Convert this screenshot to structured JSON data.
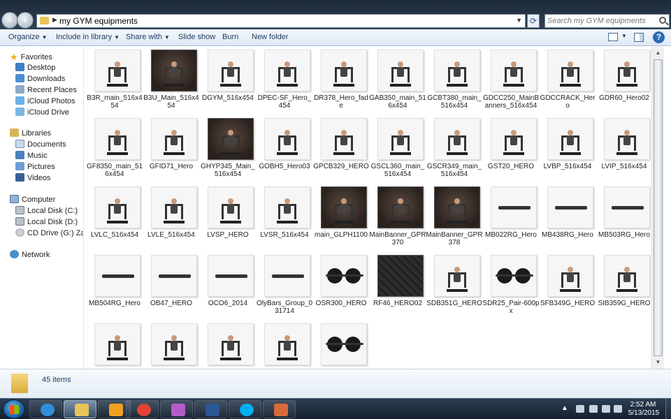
{
  "window": {
    "path": "my GYM equipments",
    "search_placeholder": "Search my GYM equipments"
  },
  "toolbar": {
    "organize": "Organize",
    "include": "Include in library",
    "share": "Share with",
    "slideshow": "Slide show",
    "burn": "Burn",
    "new_folder": "New folder"
  },
  "nav": {
    "favorites": "Favorites",
    "desktop": "Desktop",
    "downloads": "Downloads",
    "recent": "Recent Places",
    "icloud_photos": "iCloud Photos",
    "icloud_drive": "iCloud Drive",
    "libraries": "Libraries",
    "documents": "Documents",
    "music": "Music",
    "pictures": "Pictures",
    "videos": "Videos",
    "computer": "Computer",
    "disk_c": "Local Disk (C:)",
    "disk_d": "Local Disk (D:)",
    "cd_drive": "CD Drive (G:) Zain Bi",
    "network": "Network"
  },
  "files": [
    {
      "name": "B3R_main_516x454",
      "style": "light"
    },
    {
      "name": "B3U_Main_516x454",
      "style": "dark"
    },
    {
      "name": "DGYM_516x454",
      "style": "light"
    },
    {
      "name": "DPEC-SF_Hero_454",
      "style": "light"
    },
    {
      "name": "DR378_Hero_fade",
      "style": "light"
    },
    {
      "name": "GAB350_main_516x454",
      "style": "light"
    },
    {
      "name": "GCBT380_main_516x454",
      "style": "light"
    },
    {
      "name": "GDCC250_MainBanners_516x454",
      "style": "light"
    },
    {
      "name": "GDCCRACK_Hero",
      "style": "light"
    },
    {
      "name": "GDR60_Hero02",
      "style": "light"
    },
    {
      "name": "GF8350_main_516x454",
      "style": "light"
    },
    {
      "name": "GFID71_Hero",
      "style": "light"
    },
    {
      "name": "GHYP345_Main_516x454",
      "style": "dark"
    },
    {
      "name": "GOBH5_Hero03",
      "style": "light"
    },
    {
      "name": "GPCB329_HERO",
      "style": "light"
    },
    {
      "name": "GSCL360_main_516x454",
      "style": "light"
    },
    {
      "name": "GSCR349_main_516x454",
      "style": "light"
    },
    {
      "name": "GST20_HERO",
      "style": "light"
    },
    {
      "name": "LVBP_516x454",
      "style": "light"
    },
    {
      "name": "LVIP_516x454",
      "style": "light"
    },
    {
      "name": "LVLC_516x454",
      "style": "light"
    },
    {
      "name": "LVLE_516x454",
      "style": "light"
    },
    {
      "name": "LVSP_HERO",
      "style": "light"
    },
    {
      "name": "LVSR_516x454",
      "style": "light"
    },
    {
      "name": "main_GLPH1100",
      "style": "dark"
    },
    {
      "name": "MainBanner_GPR370",
      "style": "dark"
    },
    {
      "name": "MainBanner_GPR378",
      "style": "dark"
    },
    {
      "name": "MB022RG_Hero",
      "style": "bar"
    },
    {
      "name": "MB438RG_Hero",
      "style": "bar"
    },
    {
      "name": "MB503RG_Hero",
      "style": "bar"
    },
    {
      "name": "MB504RG_Hero",
      "style": "bar"
    },
    {
      "name": "OB47_HERO",
      "style": "bar"
    },
    {
      "name": "OCO6_2014",
      "style": "bar"
    },
    {
      "name": "OlyBars_Group_031714",
      "style": "bar"
    },
    {
      "name": "OSR300_HERO",
      "style": "plates"
    },
    {
      "name": "RF46_HERO02",
      "style": "mat"
    },
    {
      "name": "SDB351G_HERO",
      "style": "light"
    },
    {
      "name": "SDR25_Pair-600px",
      "style": "plates"
    },
    {
      "name": "SFB349G_HERO",
      "style": "light"
    },
    {
      "name": "SIB359G_HERO",
      "style": "light"
    },
    {
      "name": "",
      "style": "light"
    },
    {
      "name": "",
      "style": "light"
    },
    {
      "name": "",
      "style": "light"
    },
    {
      "name": "",
      "style": "light"
    },
    {
      "name": "",
      "style": "plates"
    }
  ],
  "details": {
    "count": "45 items"
  },
  "taskbar": {
    "items": [
      {
        "name": "ie",
        "color": "#2f8fde"
      },
      {
        "name": "explorer",
        "color": "#e8c55a"
      },
      {
        "name": "media",
        "color": "#f0a020"
      },
      {
        "name": "chrome",
        "color": "#e34133"
      },
      {
        "name": "app",
        "color": "#b45bc9"
      },
      {
        "name": "word",
        "color": "#2b5797"
      },
      {
        "name": "skype",
        "color": "#00aff0"
      },
      {
        "name": "paint",
        "color": "#d86a3c"
      }
    ],
    "time": "2:52 AM",
    "date": "5/13/2015"
  }
}
